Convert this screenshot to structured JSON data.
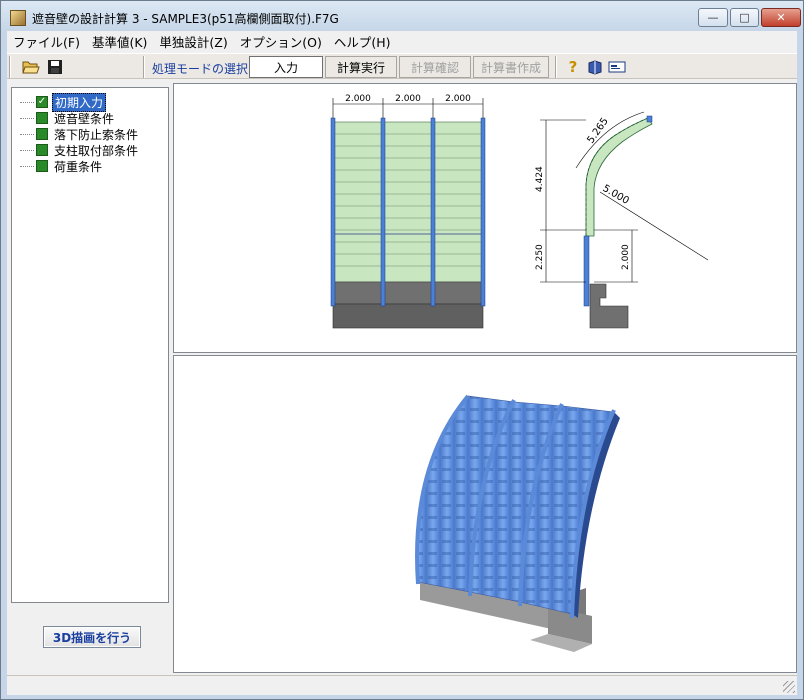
{
  "window": {
    "title": "遮音壁の設計計算 3 - SAMPLE3(p51高欄側面取付).F7G",
    "min_glyph": "—",
    "max_glyph": "□",
    "close_glyph": "✕"
  },
  "menu": {
    "items": [
      {
        "label": "ファイル(F)"
      },
      {
        "label": "基準値(K)"
      },
      {
        "label": "単独設計(Z)"
      },
      {
        "label": "オプション(O)"
      },
      {
        "label": "ヘルプ(H)"
      }
    ]
  },
  "toolbar": {
    "open_icon": "open-folder-icon",
    "save_icon": "save-disk-icon",
    "mode_label": "処理モードの選択",
    "buttons": [
      {
        "label": "入力",
        "state": "active"
      },
      {
        "label": "計算実行",
        "state": "enabled"
      },
      {
        "label": "計算確認",
        "state": "disabled"
      },
      {
        "label": "計算書作成",
        "state": "disabled"
      }
    ],
    "help_icon": "help-question-icon",
    "glyph_help": "?"
  },
  "tree": {
    "items": [
      {
        "label": "初期入力",
        "checked": true,
        "selected": true
      },
      {
        "label": "遮音壁条件",
        "checked": false,
        "selected": false
      },
      {
        "label": "落下防止索条件",
        "checked": false,
        "selected": false
      },
      {
        "label": "支柱取付部条件",
        "checked": false,
        "selected": false
      },
      {
        "label": "荷重条件",
        "checked": false,
        "selected": false
      }
    ],
    "check_glyph": "✓"
  },
  "draw3d_button": {
    "label": "3D描画を行う"
  },
  "drawing": {
    "front_dims": [
      "2.000",
      "2.000",
      "2.000"
    ],
    "side_dims": {
      "arc_length": "5.265",
      "radius": "5.000",
      "upper_height": "4.424",
      "lower_height": "2.250",
      "post_height": "2.000"
    }
  },
  "colors": {
    "panel_green": "#c8e6c0",
    "post_blue": "#4a80d8",
    "base_gray": "#707070",
    "panel_3d_blue": "#5a8ee0"
  }
}
